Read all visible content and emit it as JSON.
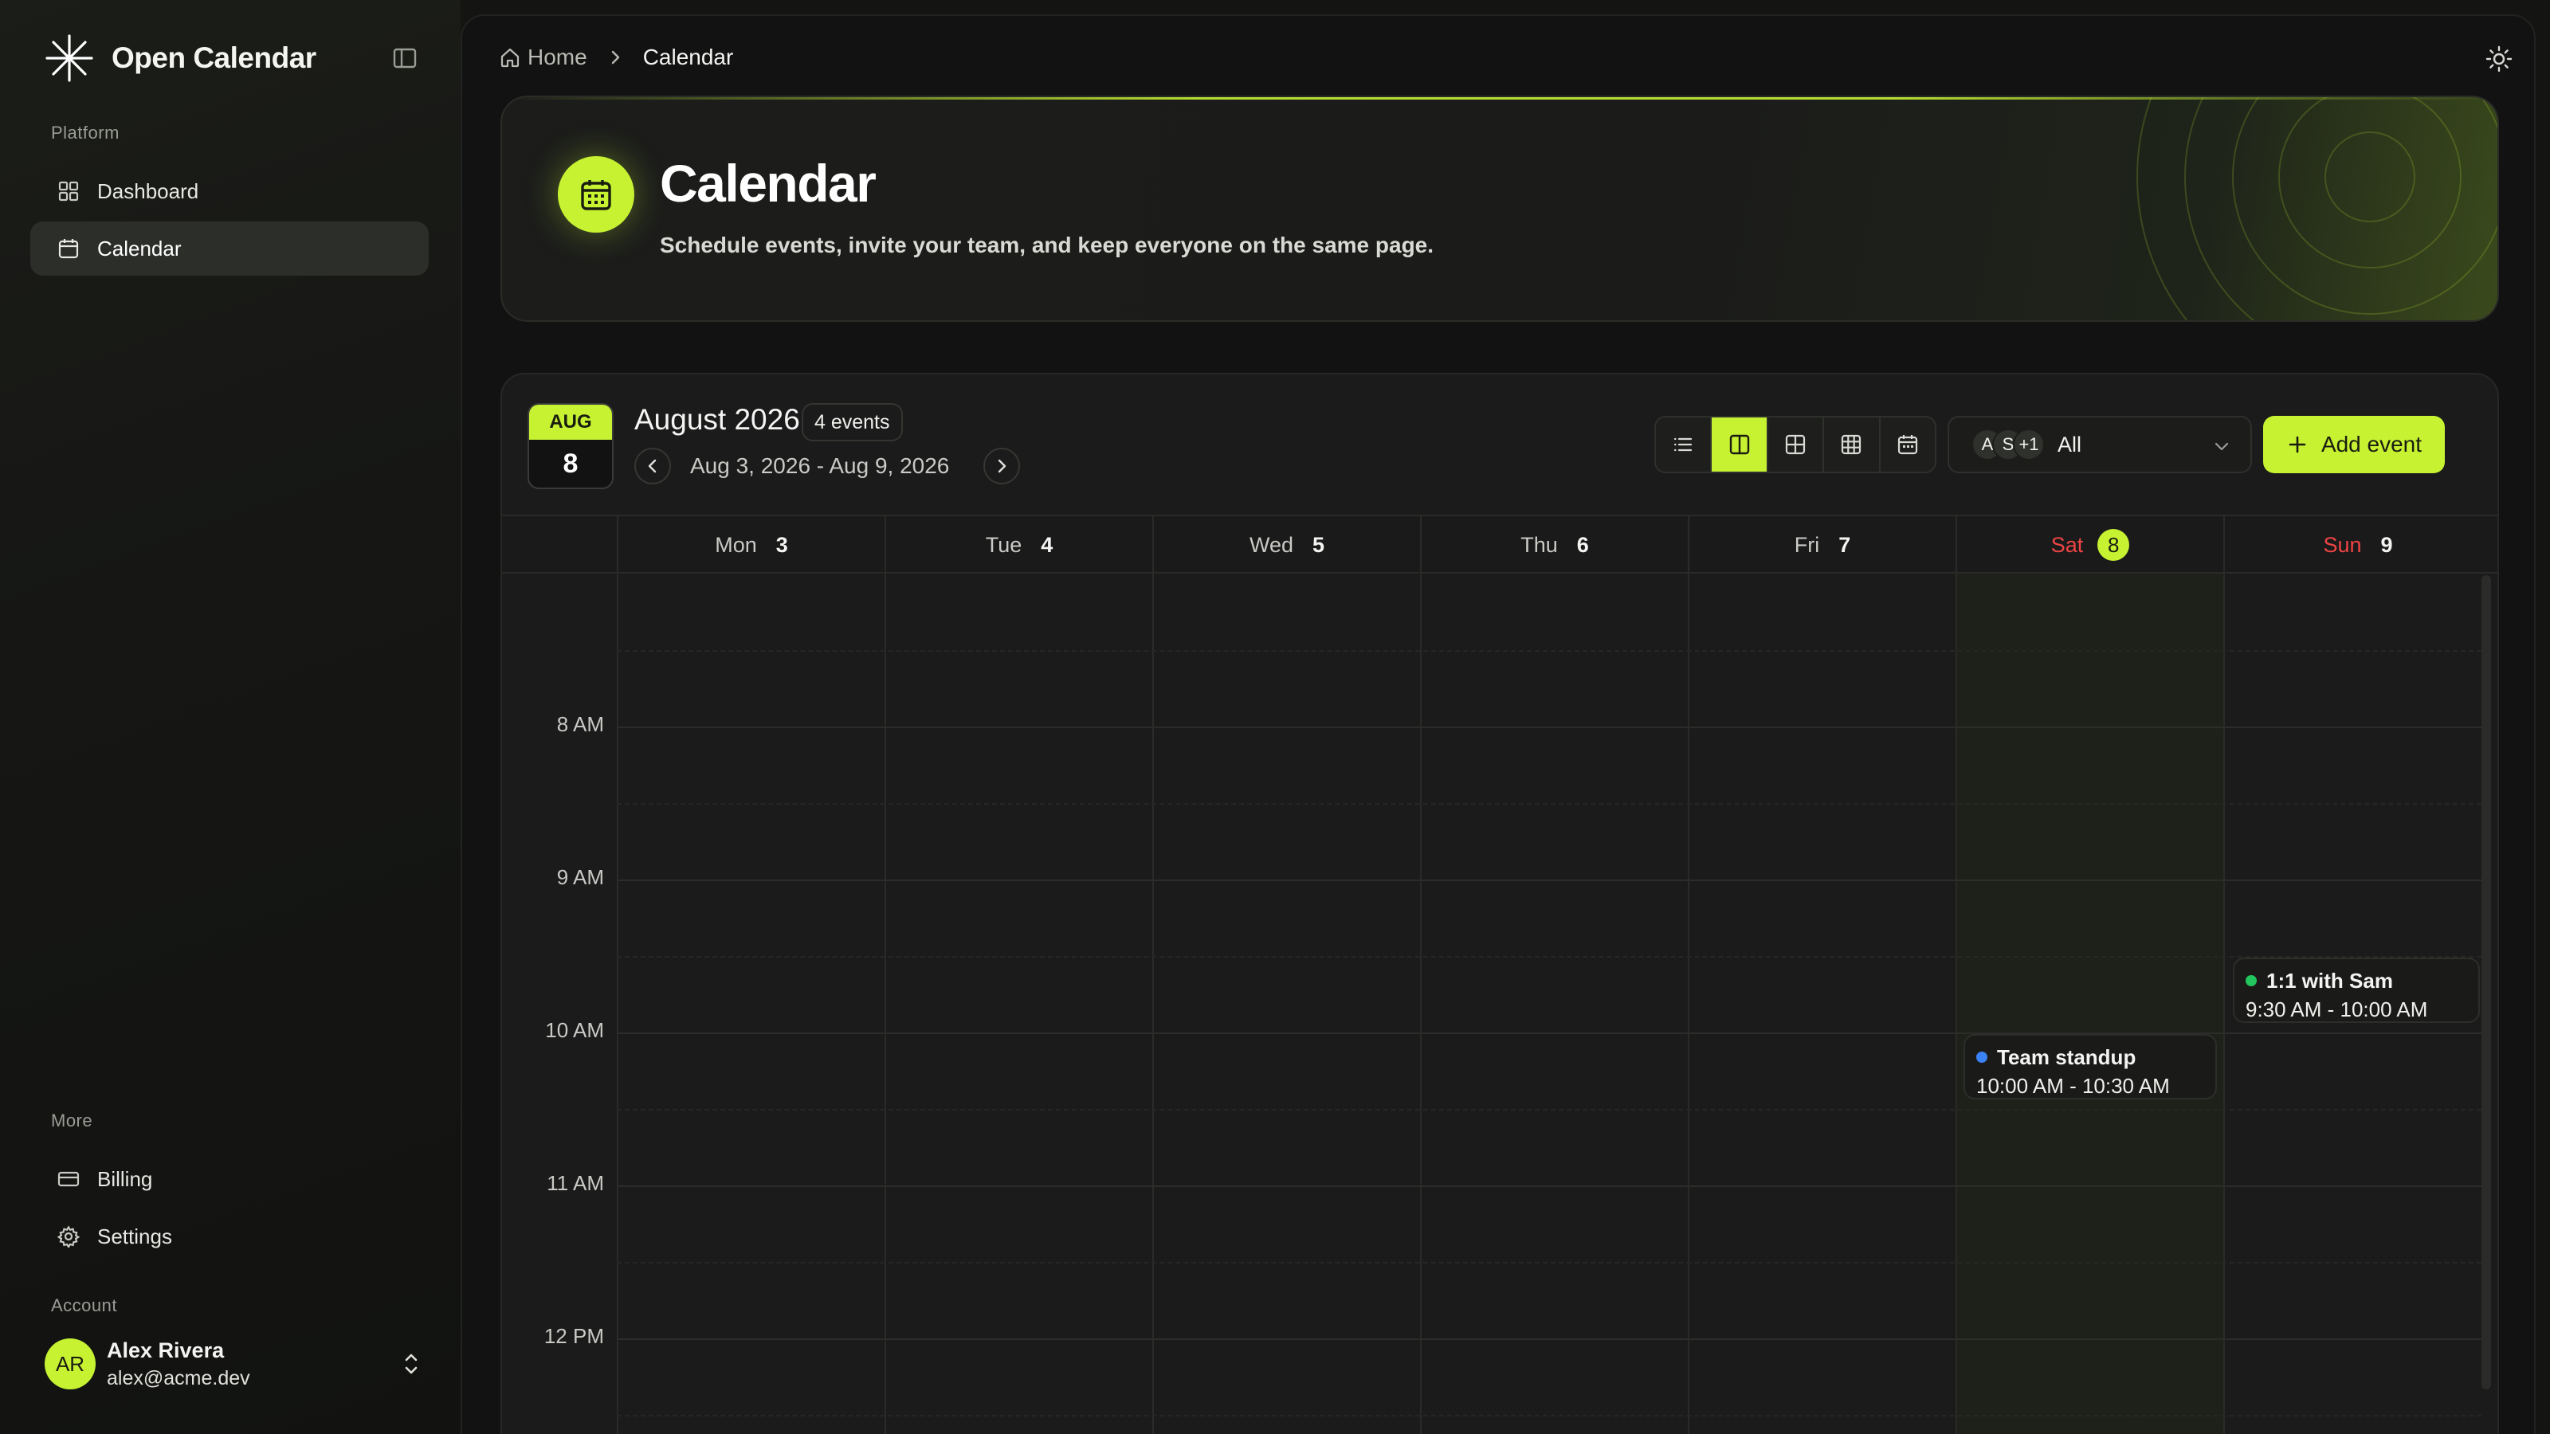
{
  "app": {
    "name": "Open Calendar"
  },
  "sidebar": {
    "platform_label": "Platform",
    "items": [
      {
        "label": "Dashboard",
        "icon": "grid-icon",
        "active": false
      },
      {
        "label": "Calendar",
        "icon": "calendar-icon",
        "active": true
      }
    ],
    "more_label": "More",
    "more_items": [
      {
        "label": "Billing",
        "icon": "credit-card-icon"
      },
      {
        "label": "Settings",
        "icon": "gear-icon"
      }
    ],
    "account_label": "Account",
    "user": {
      "initials": "AR",
      "name": "Alex Rivera",
      "email": "alex@acme.dev"
    }
  },
  "breadcrumb": {
    "home": "Home",
    "current": "Calendar"
  },
  "hero": {
    "title": "Calendar",
    "subtitle": "Schedule events, invite your team, and keep everyone on the same page."
  },
  "calendar": {
    "today_month": "AUG",
    "today_day": "8",
    "title": "August 2026",
    "event_count": "4 events",
    "range": "Aug 3, 2026 - Aug 9, 2026",
    "views": [
      "list-icon",
      "week-columns-icon",
      "grid-2x2-icon",
      "grid-3x3-icon",
      "calendar-icon"
    ],
    "active_view": 1,
    "filter": {
      "chips": [
        "A",
        "S",
        "+1"
      ],
      "label": "All"
    },
    "add_event_label": "Add event",
    "days": [
      {
        "name": "Mon",
        "num": "3"
      },
      {
        "name": "Tue",
        "num": "4"
      },
      {
        "name": "Wed",
        "num": "5"
      },
      {
        "name": "Thu",
        "num": "6"
      },
      {
        "name": "Fri",
        "num": "7"
      },
      {
        "name": "Sat",
        "num": "8"
      },
      {
        "name": "Sun",
        "num": "9"
      }
    ],
    "times": [
      "8 AM",
      "9 AM",
      "10 AM",
      "11 AM",
      "12 PM"
    ],
    "events": [
      {
        "title": "1:1 with Sam",
        "time": "9:30 AM - 10:00 AM",
        "color": "#22c55e"
      },
      {
        "title": "Team standup",
        "time": "10:00 AM - 10:30 AM",
        "color": "#3b82f6"
      }
    ]
  },
  "colors": {
    "accent": "#c6f232",
    "weekend": "#ef4444",
    "background": "#121212"
  }
}
